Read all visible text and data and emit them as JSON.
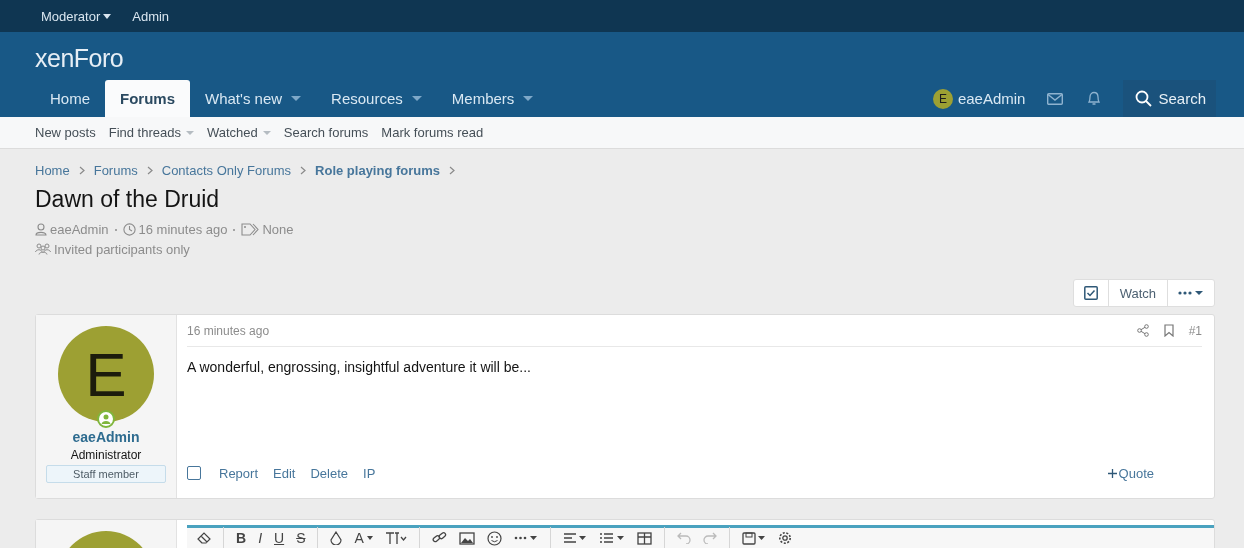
{
  "top_bar": [
    {
      "label": "Moderator",
      "dropdown": true
    },
    {
      "label": "Admin",
      "dropdown": false
    }
  ],
  "logo": "xenForo",
  "nav": {
    "tabs": [
      {
        "label": "Home",
        "selected": false,
        "dropdown": false
      },
      {
        "label": "Forums",
        "selected": true,
        "dropdown": false
      },
      {
        "label": "What's new",
        "selected": false,
        "dropdown": true
      },
      {
        "label": "Resources",
        "selected": false,
        "dropdown": true
      },
      {
        "label": "Members",
        "selected": false,
        "dropdown": true
      }
    ],
    "user": {
      "initial": "E",
      "name": "eaeAdmin"
    },
    "search": "Search"
  },
  "subnav": [
    {
      "label": "New posts",
      "dropdown": false
    },
    {
      "label": "Find threads",
      "dropdown": true
    },
    {
      "label": "Watched",
      "dropdown": true
    },
    {
      "label": "Search forums",
      "dropdown": false
    },
    {
      "label": "Mark forums read",
      "dropdown": false
    }
  ],
  "breadcrumbs": [
    {
      "label": "Home",
      "current": false
    },
    {
      "label": "Forums",
      "current": false
    },
    {
      "label": "Contacts Only Forums",
      "current": false
    },
    {
      "label": "Role playing forums",
      "current": true
    }
  ],
  "thread": {
    "title": "Dawn of the Druid",
    "author": "eaeAdmin",
    "time": "16 minutes ago",
    "tags": "None",
    "privacy": "Invited participants only"
  },
  "thread_actions": {
    "watch": "Watch"
  },
  "post": {
    "avatar_initial": "E",
    "username": "eaeAdmin",
    "role": "Administrator",
    "badge": "Staff member",
    "time": "16 minutes ago",
    "number": "#1",
    "body": "A wonderful, engrossing, insightful adventure it will be...",
    "actions": [
      "Report",
      "Edit",
      "Delete",
      "IP"
    ],
    "quote": "Quote",
    "checked": false
  },
  "editor": {
    "text_buttons": [
      "B",
      "I",
      "U",
      "S"
    ],
    "color_button": "A"
  }
}
